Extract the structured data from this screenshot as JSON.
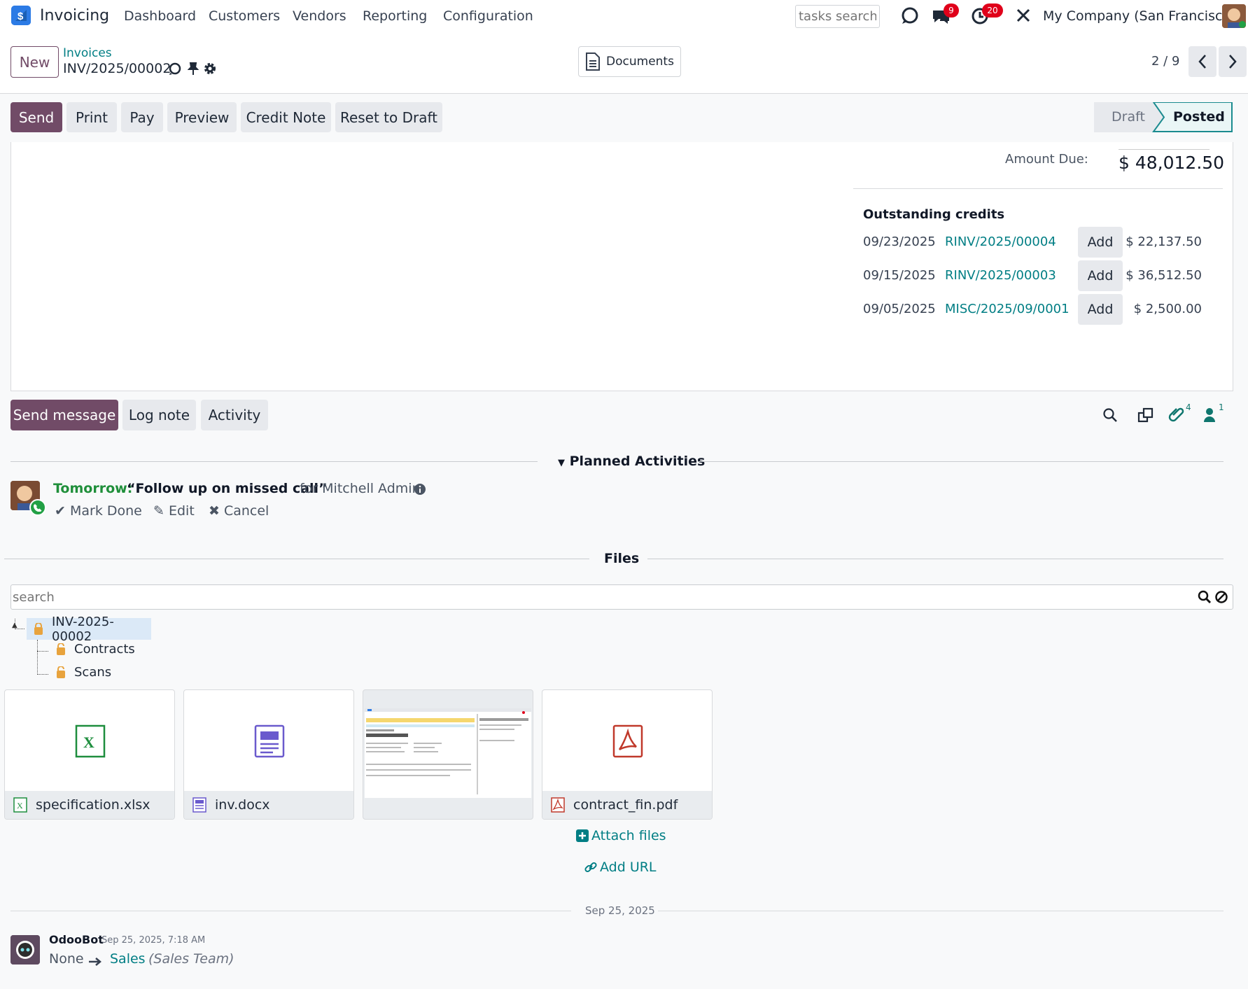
{
  "app": {
    "name": "Invoicing"
  },
  "nav": [
    "Dashboard",
    "Customers",
    "Vendors",
    "Reporting",
    "Configuration"
  ],
  "systray": {
    "search_placeholder": "tasks search",
    "messages_count": "9",
    "activities_count": "20",
    "company": "My Company (San Francisco)"
  },
  "breadcrumb": {
    "new_label": "New",
    "parent": "Invoices",
    "current": "INV/2025/00002"
  },
  "documents_button": "Documents",
  "pager": {
    "value": "2 / 9"
  },
  "actions": [
    "Send",
    "Print",
    "Pay",
    "Preview",
    "Credit Note",
    "Reset to Draft"
  ],
  "status": {
    "steps": [
      "Draft",
      "Posted"
    ],
    "active": "Posted"
  },
  "totals": {
    "amount_due_label": "Amount Due:",
    "amount_due_value": "$ 48,012.50"
  },
  "outstanding": {
    "title": "Outstanding credits",
    "add_label": "Add",
    "rows": [
      {
        "date": "09/23/2025",
        "ref": "RINV/2025/00004",
        "amount": "$ 22,137.50"
      },
      {
        "date": "09/15/2025",
        "ref": "RINV/2025/00003",
        "amount": "$ 36,512.50"
      },
      {
        "date": "09/05/2025",
        "ref": "MISC/2025/09/0001",
        "amount": "$ 2,500.00"
      }
    ]
  },
  "chatter": {
    "send_message": "Send message",
    "log_note": "Log note",
    "activity": "Activity",
    "attachments_count": "4",
    "followers_count": "1"
  },
  "planned": {
    "title": "Planned Activities",
    "when": "Tomorrow:",
    "summary": "“Follow up on missed call”",
    "for_text": "for Mitchell Admin",
    "mark_done": "Mark Done",
    "edit": "Edit",
    "cancel": "Cancel"
  },
  "files": {
    "title": "Files",
    "search_placeholder": "search",
    "tree": {
      "root": "INV-2025-00002",
      "children": [
        "Contracts",
        "Scans"
      ]
    },
    "cards": [
      {
        "name": "specification.xlsx",
        "icon": "excel-icon"
      },
      {
        "name": "inv.docx",
        "icon": "document-icon"
      },
      {
        "name": "",
        "icon": "screenshot-thumbnail"
      },
      {
        "name": "contract_fin.pdf",
        "icon": "pdf-icon"
      }
    ],
    "attach_files": "Attach files",
    "add_url": "Add URL"
  },
  "log": {
    "date_separator": "Sep 25, 2025",
    "author": "OdooBot",
    "timestamp": "Sep 25, 2025, 7:18 AM",
    "old_value": "None",
    "new_value": "Sales",
    "field": "(Sales Team)"
  }
}
